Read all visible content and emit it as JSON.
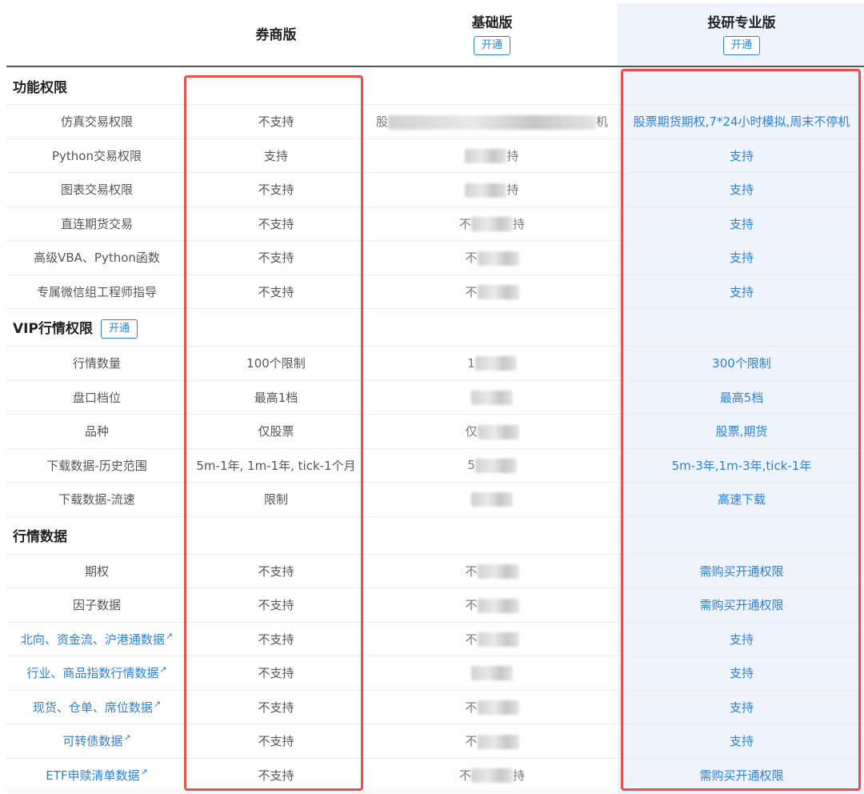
{
  "columns": {
    "broker": "券商版",
    "basic": "基础版",
    "pro": "投研专业版",
    "open_label": "开通"
  },
  "sections": [
    {
      "title": "功能权限",
      "open_button": false,
      "rows": [
        {
          "feature": "仿真交易权限",
          "broker": "不支持",
          "basic": "股",
          "basic_tail": "机",
          "pro": "股票期货期权,7*24小时模拟,周末不停机"
        },
        {
          "feature": "Python交易权限",
          "broker": "支持",
          "basic": "",
          "basic_tail": "持",
          "pro": "支持"
        },
        {
          "feature": "图表交易权限",
          "broker": "不支持",
          "basic": "",
          "basic_tail": "持",
          "pro": "支持"
        },
        {
          "feature": "直连期货交易",
          "broker": "不支持",
          "basic": "不",
          "basic_tail": "持",
          "pro": "支持"
        },
        {
          "feature": "高级VBA、Python函数",
          "broker": "不支持",
          "basic": "不",
          "basic_tail": "",
          "pro": "支持"
        },
        {
          "feature": "专属微信组工程师指导",
          "broker": "不支持",
          "basic": "不",
          "basic_tail": "",
          "pro": "支持"
        }
      ]
    },
    {
      "title": "VIP行情权限",
      "open_button": true,
      "rows": [
        {
          "feature": "行情数量",
          "broker": "100个限制",
          "basic": "1",
          "basic_tail": "",
          "pro": "300个限制"
        },
        {
          "feature": "盘口档位",
          "broker": "最高1档",
          "basic": "",
          "basic_tail": "",
          "pro": "最高5档"
        },
        {
          "feature": "品种",
          "broker": "仅股票",
          "basic": "仅",
          "basic_tail": "",
          "pro": "股票,期货"
        },
        {
          "feature": "下载数据-历史范围",
          "broker": "5m-1年, 1m-1年, tick-1个月",
          "basic": "5",
          "basic_tail": "",
          "pro": "5m-3年,1m-3年,tick-1年"
        },
        {
          "feature": "下载数据-流速",
          "broker": "限制",
          "basic": "",
          "basic_tail": "",
          "pro": "高速下载"
        }
      ]
    },
    {
      "title": "行情数据",
      "open_button": false,
      "rows": [
        {
          "feature": "期权",
          "link": false,
          "broker": "不支持",
          "basic": "不",
          "basic_tail": "",
          "pro": "需购买开通权限"
        },
        {
          "feature": "因子数据",
          "link": false,
          "broker": "不支持",
          "basic": "不",
          "basic_tail": "",
          "pro": "需购买开通权限"
        },
        {
          "feature": "北向、资金流、沪港通数据",
          "link": true,
          "broker": "不支持",
          "basic": "不",
          "basic_tail": "",
          "pro": "支持"
        },
        {
          "feature": "行业、商品指数行情数据",
          "link": true,
          "broker": "不支持",
          "basic": "",
          "basic_tail": "",
          "pro": "支持"
        },
        {
          "feature": "现货、仓单、席位数据",
          "link": true,
          "broker": "不支持",
          "basic": "不",
          "basic_tail": "",
          "pro": "支持"
        },
        {
          "feature": "可转债数据",
          "link": true,
          "broker": "不支持",
          "basic": "不",
          "basic_tail": "",
          "pro": "支持"
        },
        {
          "feature": "ETF申赎清单数据",
          "link": true,
          "broker": "不支持",
          "basic": "不",
          "basic_tail": "持",
          "pro": "需购买开通权限"
        }
      ]
    }
  ],
  "colors": {
    "accent": "#2e7fd6",
    "highlight_border": "#e8514b",
    "pro_column_bg": "#eef3fc"
  },
  "icons": {
    "external_link": "external-link-icon"
  }
}
